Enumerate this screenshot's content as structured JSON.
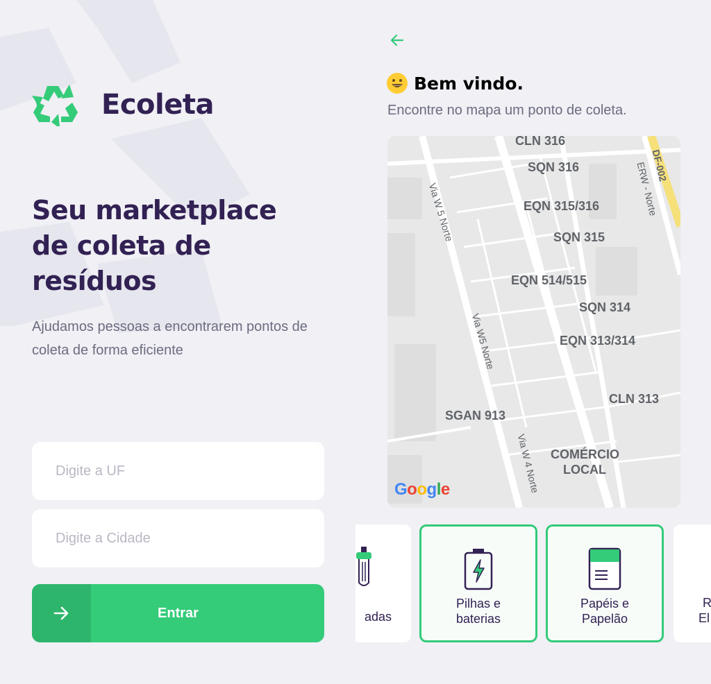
{
  "left": {
    "brand": "Ecoleta",
    "hero_title": "Seu marketplace de coleta de resíduos",
    "hero_description": "Ajudamos pessoas a encontrarem pontos de coleta de forma eficiente",
    "uf_placeholder": "Digite a UF",
    "city_placeholder": "Digite a Cidade",
    "enter_label": "Entrar"
  },
  "right": {
    "welcome_emoji": "smile-emoji",
    "welcome_title": "Bem vindo.",
    "welcome_subtitle": "Encontre no mapa um ponto de coleta.",
    "map": {
      "labels": [
        "CLN 316",
        "SQN 316",
        "EQN 315/316",
        "SQN 315",
        "EQN 514/515",
        "SQN 314",
        "EQN 313/314",
        "CLN 313",
        "SGAN 913",
        "COMÉRCIO",
        "LOCAL"
      ],
      "roads": [
        "Via W 5 Norte",
        "Via W5 Norte",
        "Via W 4 Norte",
        "ERW - Norte",
        "DF-002"
      ],
      "provider": "Google"
    },
    "items": [
      {
        "label_line1": "",
        "label_line2": "adas",
        "icon": "lamp-icon",
        "selected": false
      },
      {
        "label_line1": "Pilhas e",
        "label_line2": "baterias",
        "icon": "battery-icon",
        "selected": true
      },
      {
        "label_line1": "Papéis e",
        "label_line2": "Papelão",
        "icon": "paper-icon",
        "selected": true
      },
      {
        "label_line1": "R",
        "label_line2": "El",
        "icon": "",
        "selected": false
      }
    ]
  },
  "colors": {
    "primary": "#34CB79",
    "primary_dark": "#2EB56C",
    "title": "#322153",
    "text": "#6C6C80",
    "background": "#F0F0F5"
  }
}
